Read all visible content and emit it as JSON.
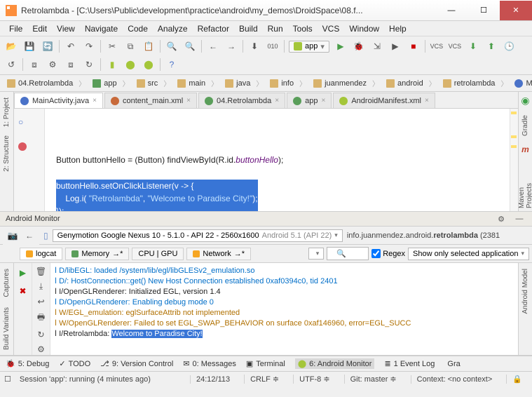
{
  "window": {
    "title": "Retrolambda - [C:\\Users\\Public\\development\\practice\\android\\my_demos\\DroidSpace\\08.f..."
  },
  "menu": [
    "File",
    "Edit",
    "View",
    "Navigate",
    "Code",
    "Analyze",
    "Refactor",
    "Build",
    "Run",
    "Tools",
    "VCS",
    "Window",
    "Help"
  ],
  "run_config": "app",
  "breadcrumb": [
    {
      "icon": "folder",
      "label": "04.Retrolambda"
    },
    {
      "icon": "module",
      "label": "app"
    },
    {
      "icon": "folder",
      "label": "src"
    },
    {
      "icon": "folder",
      "label": "main"
    },
    {
      "icon": "folder",
      "label": "java"
    },
    {
      "icon": "folder",
      "label": "info"
    },
    {
      "icon": "folder",
      "label": "juanmendez"
    },
    {
      "icon": "folder",
      "label": "android"
    },
    {
      "icon": "folder",
      "label": "retrolambda"
    },
    {
      "icon": "class",
      "label": "MainActivity"
    }
  ],
  "left_rails": [
    "1: Project",
    "2: Structure",
    "Captures",
    "Build Variants"
  ],
  "right_rails": [
    "Gradle",
    "Maven Projects",
    "Android Model"
  ],
  "tabs": [
    {
      "label": "MainActivity.java",
      "icon": "class",
      "active": true
    },
    {
      "label": "content_main.xml",
      "icon": "xml",
      "active": false
    },
    {
      "label": "04.Retrolambda",
      "icon": "module",
      "active": false
    },
    {
      "label": "app",
      "icon": "module",
      "active": false
    },
    {
      "label": "AndroidManifest.xml",
      "icon": "manifest",
      "active": false
    }
  ],
  "code": {
    "l1a": "Button buttonHello = (Button) findViewById(R.id.",
    "l1b": "buttonHello",
    "l1c": ");",
    "l2": "buttonHello.setOnClickListener(v -> {",
    "l3a": "    Log.i( ",
    "l3b": "\"Retrolambda\"",
    "l3c": ", ",
    "l3d": "\"Welcome to Paradise City!\"",
    "l3e": ");",
    "l4": "});",
    "l5": "}"
  },
  "monitor": {
    "title": "Android Monitor",
    "device": "Genymotion Google Nexus 10 - 5.1.0 - API 22 - 2560x1600",
    "deviceApi": "Android 5.1 (API 22)",
    "package": "info.juanmendez.android.",
    "packageBold": "retrolambda",
    "packagePid": "(2381",
    "tabs": [
      "logcat",
      "Memory",
      "CPU | GPU",
      "Network"
    ],
    "logLevel": "",
    "regex": "Regex",
    "filter": "Show only selected application",
    "deviceIcons": [
      "camera",
      "back"
    ]
  },
  "log": [
    {
      "lvl": "D",
      "tag": "libEGL",
      "msg": "loaded /system/lib/egl/libGLESv2_emulation.so"
    },
    {
      "lvl": "D",
      "tag": "",
      "msg": "HostConnection::get() New Host Connection established 0xaf0394c0, tid 2401"
    },
    {
      "lvl": "I",
      "tag": "OpenGLRenderer",
      "msg": "Initialized EGL, version 1.4"
    },
    {
      "lvl": "D",
      "tag": "OpenGLRenderer",
      "msg": "Enabling debug mode 0"
    },
    {
      "lvl": "W",
      "tag": "EGL_emulation",
      "msg": "eglSurfaceAttrib not implemented"
    },
    {
      "lvl": "W",
      "tag": "OpenGLRenderer",
      "msg": "Failed to set EGL_SWAP_BEHAVIOR on surface 0xaf146960, error=EGL_SUCC"
    },
    {
      "lvl": "I",
      "tag": "Retrolambda",
      "msg": "Welcome to Paradise City!",
      "sel": true
    }
  ],
  "bottomTabs": [
    "5: Debug",
    "TODO",
    "9: Version Control",
    "0: Messages",
    "Terminal",
    "6: Android Monitor",
    "1 Event Log",
    "Gra"
  ],
  "bottomActive": "6: Android Monitor",
  "status": {
    "msg": "Session 'app': running (4 minutes ago)",
    "pos": "24:12/113",
    "eol": "CRLF",
    "enc": "UTF-8",
    "git": "Git: master",
    "ctx": "Context: <no context>"
  }
}
